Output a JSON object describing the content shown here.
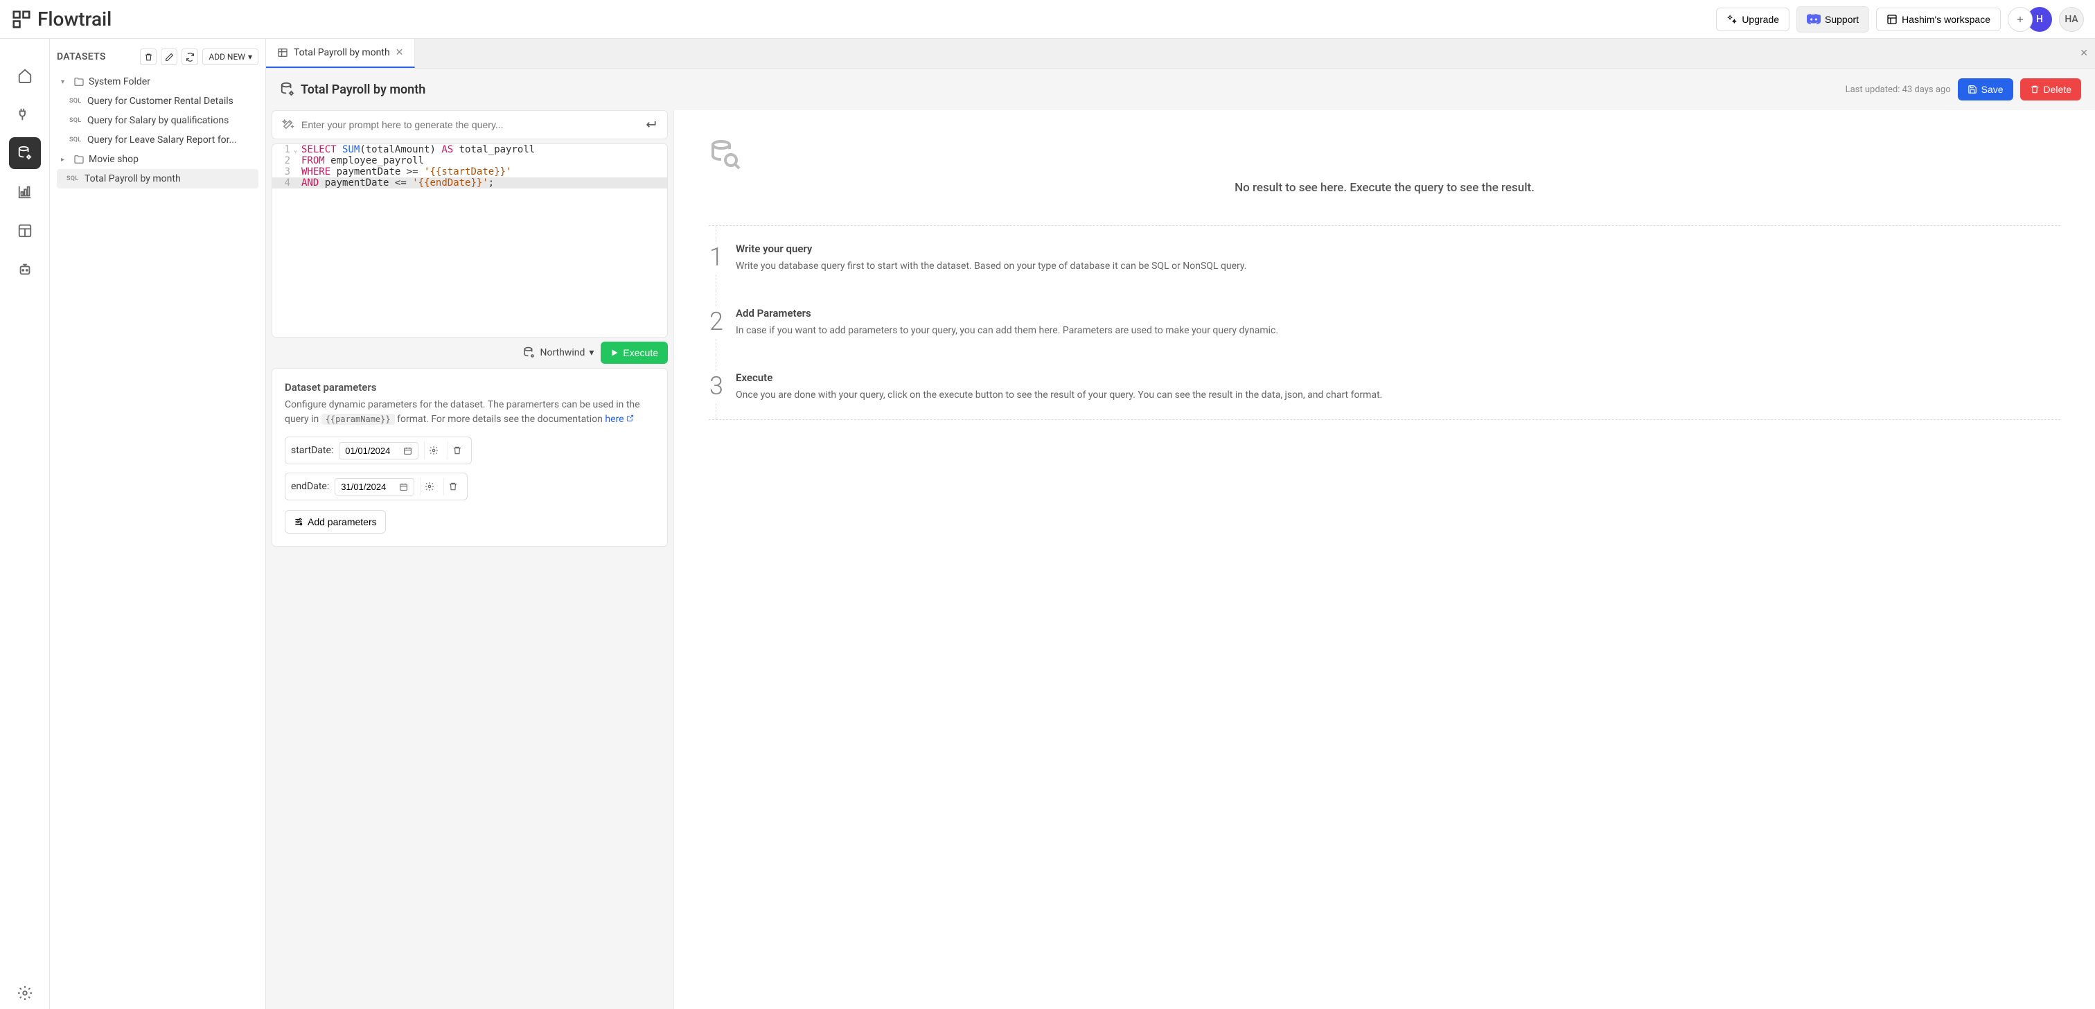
{
  "brand": "Flowtrail",
  "header": {
    "upgrade": "Upgrade",
    "support": "Support",
    "workspace": "Hashim's workspace",
    "avatar1": "H",
    "avatar2": "HA"
  },
  "sidebar": {
    "title": "DATASETS",
    "add_new": "ADD NEW",
    "folders": {
      "system": "System Folder",
      "movie": "Movie shop"
    },
    "queries": {
      "rental": "Query for Customer Rental Details",
      "salary": "Query for Salary by qualifications",
      "leave": "Query for Leave Salary Report for...",
      "payroll": "Total Payroll by month"
    }
  },
  "tab": {
    "label": "Total Payroll by month"
  },
  "page": {
    "title": "Total Payroll by month",
    "last_updated": "Last updated: 43 days ago",
    "save": "Save",
    "delete": "Delete"
  },
  "prompt": {
    "placeholder": "Enter your prompt here to generate the query..."
  },
  "code": {
    "l1a": "SELECT",
    "l1b": "SUM",
    "l1c": "(totalAmount)",
    "l1d": "AS",
    "l1e": "total_payroll",
    "l2a": "FROM",
    "l2b": "employee_payroll",
    "l3a": "WHERE",
    "l3b": "paymentDate",
    "l3c": ">=",
    "l3d": "'{{startDate}}'",
    "l4a": "AND",
    "l4b": "paymentDate",
    "l4c": "<=",
    "l4d": "'{{endDate}}'",
    "l4e": ";"
  },
  "execbar": {
    "db": "Northwind",
    "execute": "Execute"
  },
  "params": {
    "title": "Dataset parameters",
    "desc1": "Configure dynamic parameters for the dataset. The paramerters can be used in the query in",
    "code": "{{paramName}}",
    "desc2": "format. For more details see the documentation",
    "here": "here",
    "start_label": "startDate:",
    "start_value": "01/01/2024",
    "end_label": "endDate:",
    "end_value": "31/01/2024",
    "add": "Add parameters"
  },
  "empty": {
    "text": "No result to see here. Execute the query to see the result."
  },
  "steps": {
    "s1t": "Write your query",
    "s1d": "Write you database query first to start with the dataset. Based on your type of database it can be SQL or NonSQL query.",
    "s2t": "Add Parameters",
    "s2d": "In case if you want to add parameters to your query, you can add them here. Parameters are used to make your query dynamic.",
    "s3t": "Execute",
    "s3d": "Once you are done with your query, click on the execute button to see the result of your query. You can see the result in the data, json, and chart format."
  }
}
